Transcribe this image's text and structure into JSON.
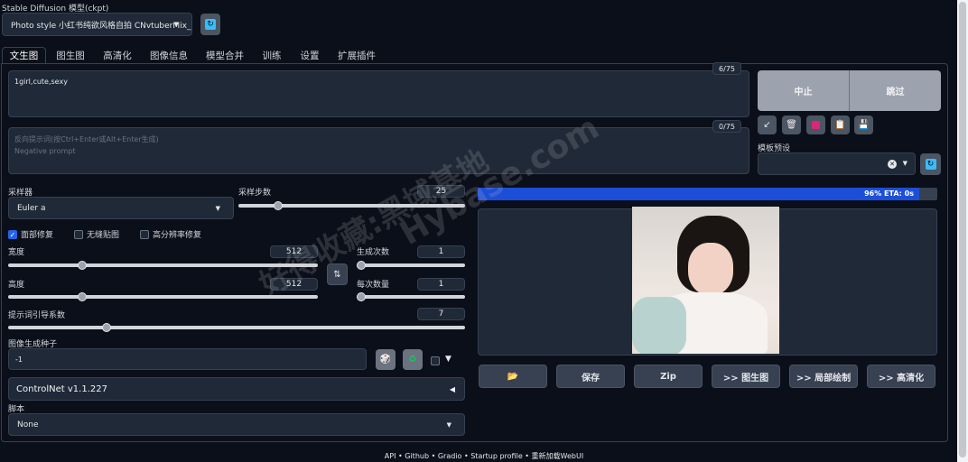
{
  "checkpoint": {
    "label": "Stable Diffusion 模型(ckpt)",
    "value": "Photo style 小红书纯欲风格自拍 CNvtuberMix_",
    "refresh_icon": "refresh-icon"
  },
  "tabs": [
    "文生图",
    "图生图",
    "高清化",
    "图像信息",
    "模型合并",
    "训练",
    "设置",
    "扩展插件"
  ],
  "prompt": {
    "value": "1girl,cute,sexy",
    "counter": "6/75"
  },
  "negative": {
    "placeholder": "反向提示词(按Ctrl+Enter或Alt+Enter生成)\nNegative prompt",
    "counter": "0/75"
  },
  "actions": {
    "interrupt": "中止",
    "skip": "跳过"
  },
  "styles": {
    "label": "模板预设",
    "clear": "✕"
  },
  "sampler": {
    "label": "采样器",
    "value": "Euler a",
    "steps_label": "采样步数",
    "steps": "25",
    "steps_fraction": 0.16
  },
  "checkboxes": {
    "restore_faces": "面部修复",
    "tiling": "无缝贴图",
    "hires_fix": "高分辨率修复"
  },
  "size": {
    "width_label": "宽度",
    "width": "512",
    "width_fraction": 0.23,
    "height_label": "高度",
    "height": "512",
    "height_fraction": 0.23,
    "batch_count_label": "生成次数",
    "batch_count": "1",
    "batch_size_label": "每次数量",
    "batch_size": "1"
  },
  "cfg": {
    "label": "提示词引导系数",
    "value": "7",
    "fraction": 0.21
  },
  "seed": {
    "label": "图像生成种子",
    "value": "-1"
  },
  "controlnet": {
    "label": "ControlNet v1.1.227"
  },
  "script": {
    "label": "脚本",
    "value": "None"
  },
  "progress": {
    "text": "96% ETA: 0s",
    "fraction": 0.96
  },
  "output_buttons": [
    "📂",
    "保存",
    "Zip",
    ">> 图生图",
    ">> 局部绘制",
    ">> 高清化"
  ],
  "footer": "API  •  Github  •  Gradio  •  Startup profile  •  重新加载WebUI",
  "watermark": {
    "line1": "好得收藏:黑域基地",
    "line2": "Hybase.com"
  },
  "colors": {
    "accent": "#2563eb",
    "panel": "#1f2937",
    "bg": "#0b0f19"
  }
}
